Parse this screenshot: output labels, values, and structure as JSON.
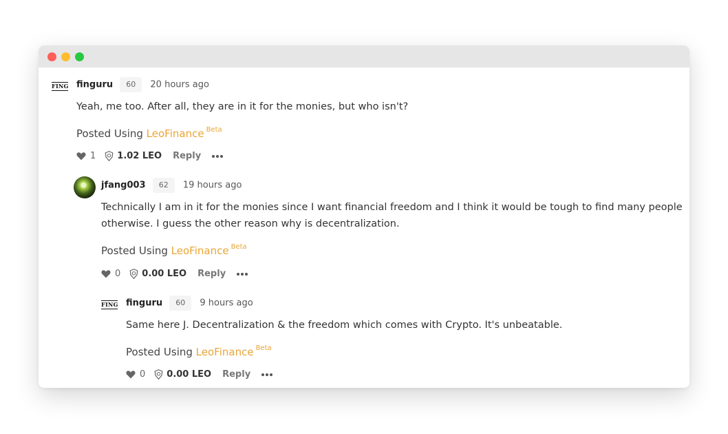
{
  "comments": [
    {
      "author": "finguru",
      "avatar_text": "FING",
      "rep": "60",
      "time": "20 hours ago",
      "body": "Yeah, me too. After all, they are in it for the monies, but who isn't?",
      "posted_prefix": "Posted Using ",
      "posted_link": "LeoFinance",
      "posted_beta": "Beta",
      "votes": "1",
      "payout": "1.02 LEO",
      "reply": "Reply"
    },
    {
      "author": "jfang003",
      "rep": "62",
      "time": "19 hours ago",
      "body": "Technically I am in it for the monies since I want financial freedom and I think it would be tough to find many people otherwise. I guess the other reason why is decentralization.",
      "posted_prefix": "Posted Using ",
      "posted_link": "LeoFinance",
      "posted_beta": "Beta",
      "votes": "0",
      "payout": "0.00 LEO",
      "reply": "Reply"
    },
    {
      "author": "finguru",
      "avatar_text": "FING",
      "rep": "60",
      "time": "9 hours ago",
      "body": "Same here J. Decentralization & the freedom which comes with Crypto. It's unbeatable.",
      "posted_prefix": "Posted Using ",
      "posted_link": "LeoFinance",
      "posted_beta": "Beta",
      "votes": "0",
      "payout": "0.00 LEO",
      "reply": "Reply"
    }
  ],
  "icons": {
    "heart": "heart-icon",
    "leo": "leo-token-icon",
    "more": "more-options-icon"
  },
  "colors": {
    "accent": "#e9a536",
    "titlebar": "#e6e6e6",
    "close": "#fe5f57",
    "minimize": "#febc2e",
    "maximize": "#28c840"
  }
}
